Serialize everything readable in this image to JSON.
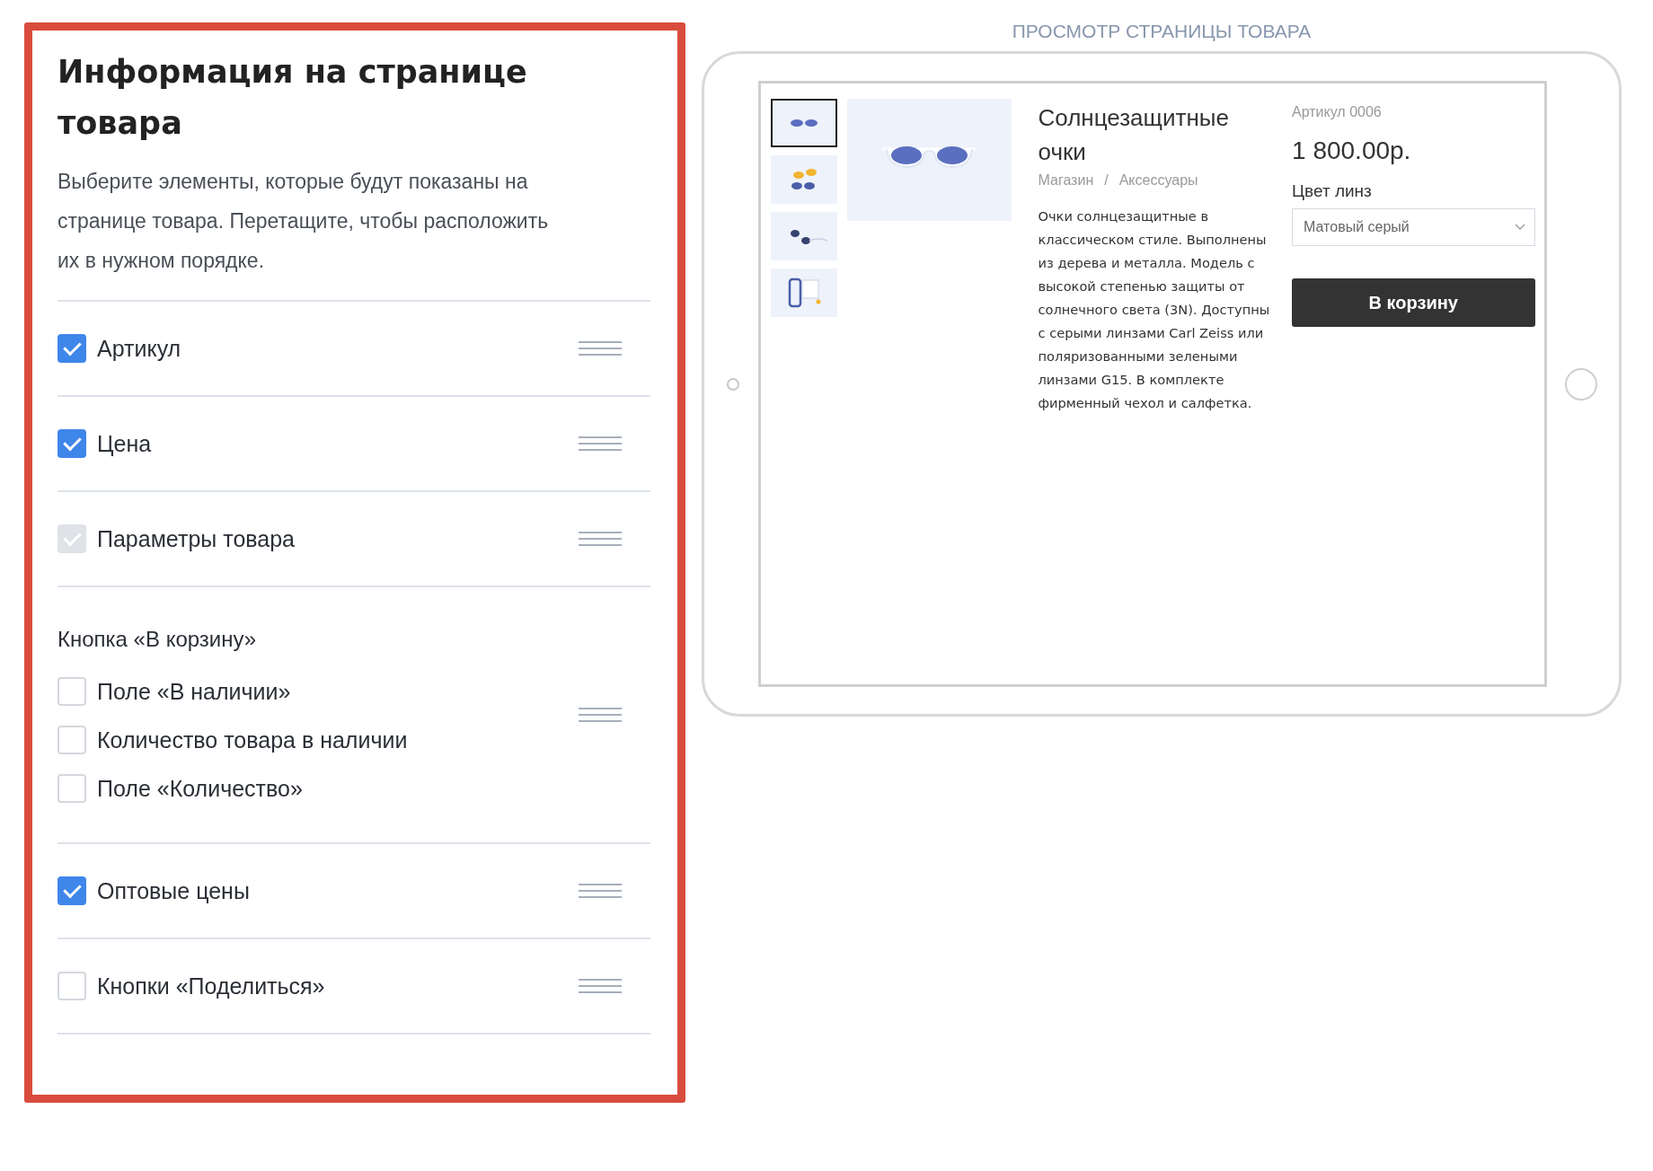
{
  "settings_panel": {
    "title": "Информация на странице товара",
    "description": "Выберите элементы, которые будут показаны на странице товара. Перетащите, чтобы расположить их в нужном порядке.",
    "items": [
      {
        "kind": "checkbox",
        "label": "Артикул",
        "checked": true,
        "disabled": false
      },
      {
        "kind": "checkbox",
        "label": "Цена",
        "checked": true,
        "disabled": false
      },
      {
        "kind": "checkbox",
        "label": "Параметры товара",
        "checked": true,
        "disabled": true
      },
      {
        "kind": "group",
        "label": "Кнопка «В корзину»",
        "options": [
          {
            "label": "Поле «В наличии»",
            "checked": false,
            "disabled": false
          },
          {
            "label": "Количество товара в наличии",
            "checked": false,
            "disabled": false
          },
          {
            "label": "Поле «Количество»",
            "checked": false,
            "disabled": false
          }
        ]
      },
      {
        "kind": "checkbox",
        "label": "Оптовые цены",
        "checked": true,
        "disabled": false
      },
      {
        "kind": "checkbox",
        "label": "Кнопки «Поделиться»",
        "checked": false,
        "disabled": false
      }
    ]
  },
  "preview": {
    "heading": "ПРОСМОТР СТРАНИЦЫ ТОВАРА",
    "thumbnails": [
      {
        "kind": "front",
        "selected": true
      },
      {
        "kind": "pair",
        "selected": false
      },
      {
        "kind": "side",
        "selected": false
      },
      {
        "kind": "case",
        "selected": false
      }
    ],
    "product_title": "Солнцезащитные очки",
    "breadcrumbs": [
      "Магазин",
      "Аксессуары"
    ],
    "breadcrumb_separator": "/",
    "product_description": "Очки солнцезащитные в классическом стиле. Выполнены из дерева и металла. Модель с высокой степенью защиты от солнечного света (3N). Доступны с серыми линзами Carl Zeiss или поляризованными зелеными линзами G15. В комплекте фирменный чехол и салфетка.",
    "sku": "Артикул 0006",
    "price": "1 800.00р.",
    "option_label": "Цвет линз",
    "option_value": "Матовый серый",
    "cart_button": "В корзину"
  }
}
